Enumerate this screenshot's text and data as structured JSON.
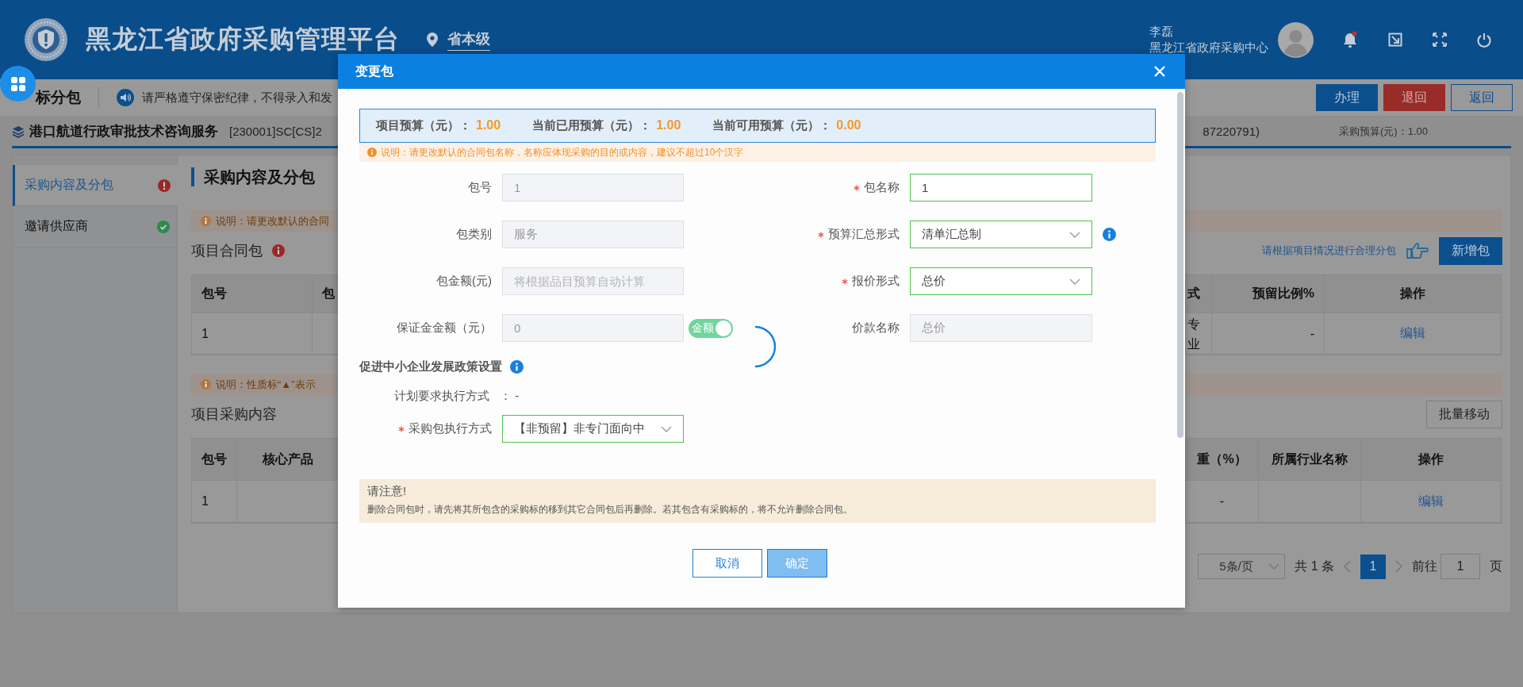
{
  "header": {
    "title": "黑龙江省政府采购管理平台",
    "region": "省本级",
    "user_name": "李磊",
    "organization": "黑龙江省政府采购中心"
  },
  "toolbar": {
    "page_title": "标分包",
    "notice": "请严格遵守保密纪律，不得录入和发",
    "buttons": [
      {
        "label": "办理",
        "kind": "primary"
      },
      {
        "label": "退回",
        "kind": "danger"
      },
      {
        "label": "返回",
        "kind": "outline"
      }
    ]
  },
  "project": {
    "name": "港口航道行政审批技术咨询服务",
    "code": "[230001]SC[CS]2",
    "contact": "87220791)",
    "budget_label": "采购预算(元)：",
    "budget": "1.00"
  },
  "sidebar": {
    "items": [
      {
        "label": "采购内容及分包",
        "selected": true,
        "complete": false
      },
      {
        "label": "邀请供应商",
        "selected": false,
        "complete": true
      }
    ]
  },
  "content": {
    "heading": "采购内容及分包",
    "packages": {
      "notice": "说明：请更改默认的合同",
      "title": "项目合同包",
      "hint": "请根据项目情况进行合理分包",
      "add_button": "新增包",
      "columns": [
        {
          "label": "包号",
          "kind": "left"
        },
        {
          "label": "包",
          "kind": "left"
        },
        {
          "label": "式",
          "kind": "narrow"
        },
        {
          "label": "预留比例%",
          "kind": "right"
        },
        {
          "label": "操作",
          "kind": "link"
        }
      ],
      "rows": [
        {
          "column_1": "1",
          "column_3": "专业",
          "column_4": "-",
          "column_5": "编辑"
        }
      ]
    },
    "items": {
      "notice": "说明：性质标“▲”表示",
      "title": "项目采购内容",
      "move_button": "批量移动",
      "columns": [
        {
          "label": "包号",
          "kind": "left"
        },
        {
          "label": "核心产品",
          "kind": "center"
        },
        {
          "label": "重（%）",
          "kind": "center"
        },
        {
          "label": "所属行业名称",
          "kind": "center"
        },
        {
          "label": "操作",
          "kind": "link"
        }
      ],
      "rows": [
        {
          "column_1": "1",
          "column_3": "-",
          "column_5": "编辑"
        }
      ]
    },
    "pagination": {
      "page_size": "5条/页",
      "total": "共 1 条",
      "pages": [
        {
          "label": "1",
          "selected": true
        }
      ],
      "goto_label": "前往",
      "goto_value": "1",
      "goto_unit": "页"
    }
  },
  "dialog": {
    "title": "变更包",
    "budget": [
      {
        "label": "项目预算（元）：",
        "value": "1.00"
      },
      {
        "label": "当前已用预算（元）：",
        "value": "1.00"
      },
      {
        "label": "当前可用预算（元）：",
        "value": "0.00"
      }
    ],
    "notice": "说明：请更改默认的合同包名称，名称应体现采购的目的或内容，建议不超过10个汉字",
    "fields": [
      {
        "label": "包号",
        "kind": "text",
        "value": "1",
        "disabled": true,
        "required": false
      },
      {
        "label": "包名称",
        "kind": "text",
        "value": "1",
        "disabled": false,
        "required": true
      },
      {
        "label": "包类别",
        "kind": "text",
        "value": "服务",
        "disabled": true,
        "required": false
      },
      {
        "label": "预算汇总形式",
        "kind": "select",
        "value": "清单汇总制",
        "disabled": false,
        "required": true,
        "info": true
      },
      {
        "label": "包金额(元)",
        "kind": "text",
        "placeholder": "将根据品目预算自动计算",
        "disabled": true,
        "required": false
      },
      {
        "label": "报价形式",
        "kind": "select",
        "value": "总价",
        "disabled": false,
        "required": true
      },
      {
        "label": "保证金金额（元）",
        "kind": "text",
        "value": "0",
        "disabled": true,
        "required": false,
        "toggle": {
          "label": "金额",
          "on": true
        }
      },
      {
        "label": "价款名称",
        "kind": "text",
        "value": "总价",
        "disabled": true,
        "required": false
      }
    ],
    "policy": {
      "title": "促进中小企业发展政策设置",
      "plan_label": "计划要求执行方式",
      "plan_value": "： -",
      "mode": {
        "label": "采购包执行方式",
        "value": "【非预留】非专门面向中",
        "required": true
      }
    },
    "attention": {
      "title": "请注意!",
      "text": "删除合同包时，请先将其所包含的采购标的移到其它合同包后再删除。若其包含有采购标的，将不允许删除合同包。"
    },
    "buttons": [
      {
        "label": "取消",
        "kind": "cancel"
      },
      {
        "label": "确定",
        "kind": "confirm"
      }
    ],
    "loading": true
  }
}
